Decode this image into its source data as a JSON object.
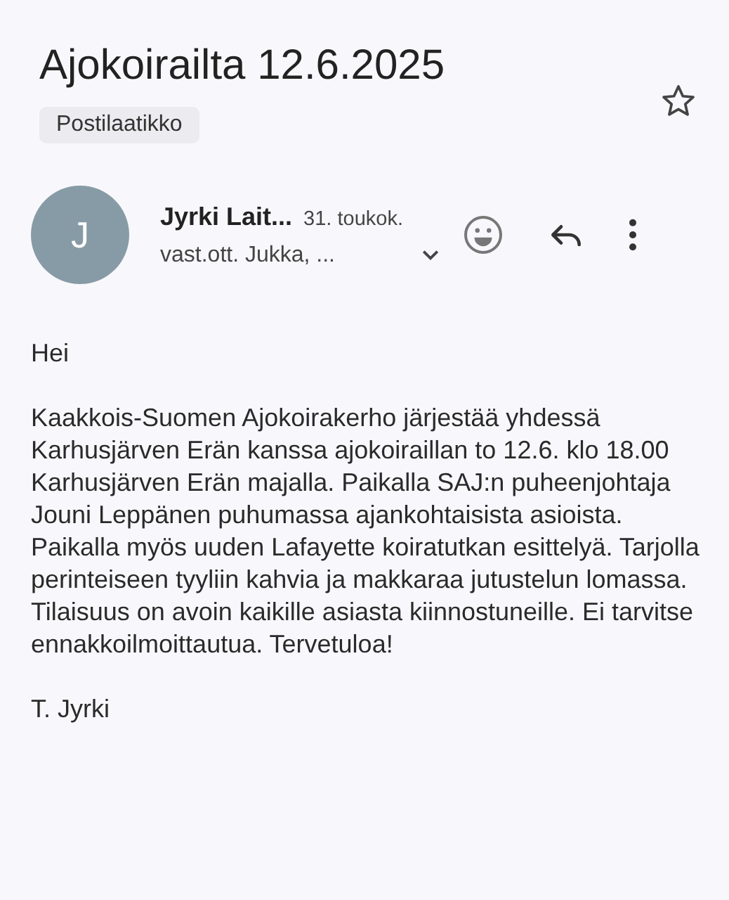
{
  "subject": "Ajokoirailta 12.6.2025",
  "starred": false,
  "label": "Postilaatikko",
  "sender": {
    "initial": "J",
    "name": "Jyrki Lait...",
    "date": "31. toukok.",
    "recipients": "vast.ott. Jukka, ..."
  },
  "body": [
    "Hei",
    "Kaakkois-Suomen Ajokoirakerho järjestää yhdessä Karhusjärven Erän kanssa ajokoiraillan to 12.6. klo 18.00 Karhusjärven Erän majalla. Paikalla SAJ:n puheenjohtaja Jouni Leppänen puhumassa ajankohtaisista asioista. Paikalla myös uuden Lafayette koiratutkan esittelyä. Tarjolla perinteiseen tyyliin kahvia ja makkaraa jutustelun lomassa. Tilaisuus on avoin kaikille asiasta kiinnostuneille. Ei tarvitse ennakkoilmoittautua. Tervetuloa!",
    "T. Jyrki"
  ]
}
